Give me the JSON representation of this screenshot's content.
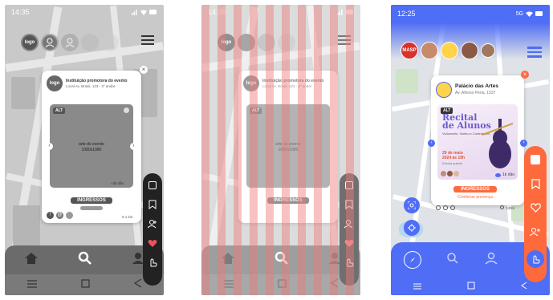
{
  "colors": {
    "gray_dark": "#3b3b3b",
    "gray_mid": "#8c8c8c",
    "blue": "#4f6df5",
    "orange": "#ff6a3d",
    "stripe_red": "#ec7878"
  },
  "wireframe": {
    "status_time": "14:35",
    "logo_text": "logo",
    "institution": "Instituição promotora do evento",
    "address": "Local Av. Brasil, 123 - 3º andar",
    "alt_badge": "ALT",
    "art_line1": "arte do evento",
    "art_line2": "1080x1080",
    "tickets": "INGRESSOS",
    "distance": "0.1 km",
    "mini_count": "+2k não",
    "close_icon": "close-icon",
    "side_icons": [
      "dice-icon",
      "bookmark-icon",
      "add-user-icon",
      "heart-icon",
      "tap-icon"
    ],
    "nav_icons": [
      "home-icon",
      "search-icon",
      "user-icon"
    ],
    "sys_icons": [
      "menu-icon",
      "square-icon",
      "back-icon"
    ]
  },
  "final": {
    "status_time": "12:25",
    "status_net": "5G",
    "avatar_masp": "MASP",
    "venue": "Palácio das Artes",
    "address": "Av. Afonso Pena, 1537",
    "alt_badge": "ALT",
    "event_title_1": "Recital",
    "event_title_2": "de Alunos",
    "event_sub": "Violoncello, Violino e Contrabaixo",
    "event_date_1": "29 de maio",
    "event_date_2": "2024 às 19h",
    "event_extra": "Entrada gratuita",
    "likes": "1k irão",
    "tickets": "INGRESSOS",
    "confirm": "Confirmar presença",
    "distance": "140m"
  }
}
